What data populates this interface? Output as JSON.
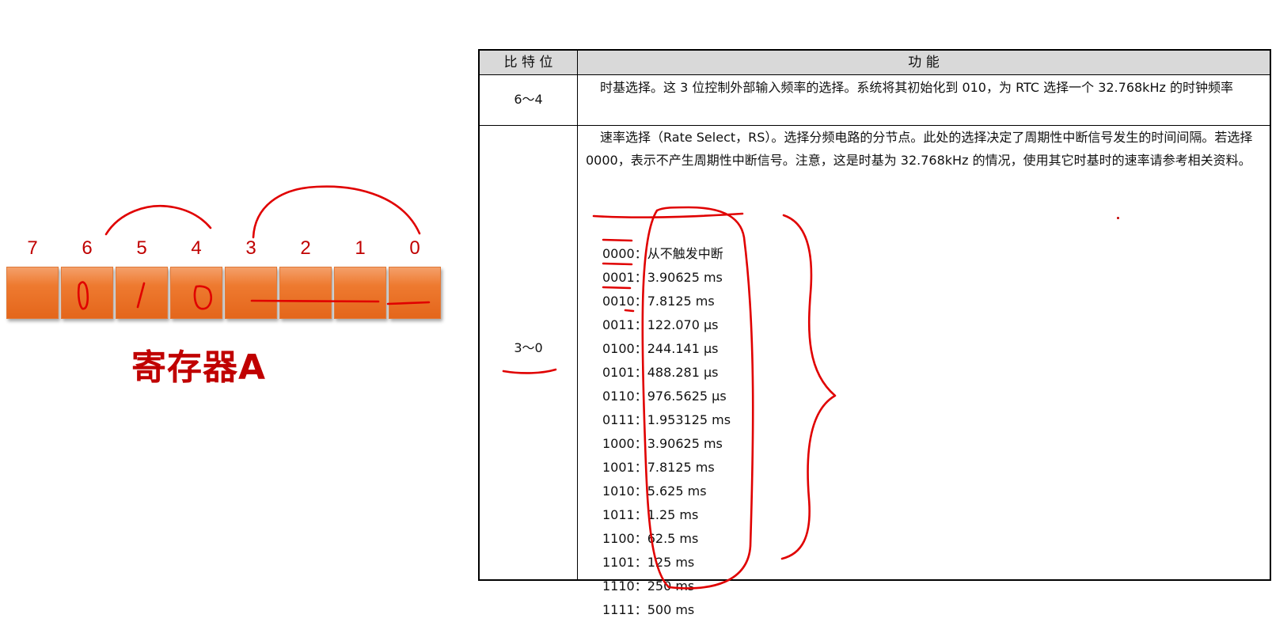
{
  "register": {
    "bit_numbers": [
      "7",
      "6",
      "5",
      "4",
      "3",
      "2",
      "1",
      "0"
    ],
    "title": "寄存器A"
  },
  "table": {
    "headers": {
      "bits": "比 特 位",
      "function": "功    能"
    },
    "rows": [
      {
        "bits": "6～4",
        "text": "时基选择。这 3 位控制外部输入频率的选择。系统将其初始化到 010，为 RTC 选择一个 32.768kHz 的时钟频率"
      },
      {
        "bits": "3～0",
        "text": "速率选择（Rate Select，RS）。选择分频电路的分节点。此处的选择决定了周期性中断信号发生的时间间隔。若选择 0000，表示不产生周期性中断信号。注意，这是时基为 32.768kHz 的情况，使用其它时基时的速率请参考相关资料。",
        "rates": [
          "0000：从不触发中断",
          "0001：3.90625 ms",
          "0010：7.8125 ms",
          "0011：122.070 µs",
          "0100：244.141 µs",
          "0101：488.281 µs",
          "0110：976.5625 µs",
          "0111：1.953125 ms",
          "1000：3.90625 ms",
          "1001：7.8125 ms",
          "1010：5.625 ms",
          "1011：1.25 ms",
          "1100：62.5 ms",
          "1101：125 ms",
          "1110：250 ms",
          "1111：500 ms"
        ]
      }
    ]
  },
  "colors": {
    "annotation": "#e00000",
    "cell": "#ee7a30",
    "title": "#c00000",
    "header_bg": "#d9d9d9"
  }
}
